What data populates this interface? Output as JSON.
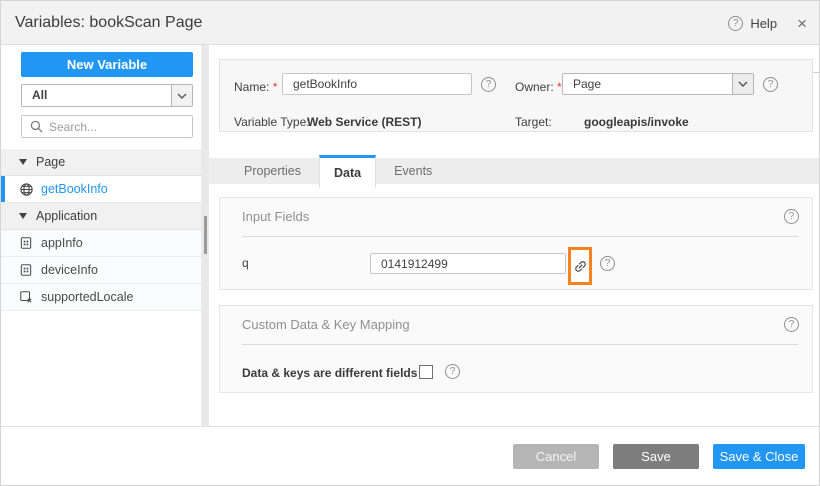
{
  "window": {
    "title": "Variables: bookScan Page"
  },
  "header": {
    "help_label": "Help"
  },
  "sidebar": {
    "new_variable_label": "New Variable",
    "filter_value": "All",
    "search_placeholder": "Search...",
    "tree": [
      {
        "type": "category",
        "label": "Page",
        "expanded": true
      },
      {
        "type": "item",
        "label": "getBookInfo",
        "icon": "web-service-icon",
        "selected": true
      },
      {
        "type": "category",
        "label": "Application",
        "expanded": true
      },
      {
        "type": "item",
        "label": "appInfo",
        "icon": "device-icon",
        "selected": false
      },
      {
        "type": "item",
        "label": "deviceInfo",
        "icon": "device-icon",
        "selected": false
      },
      {
        "type": "item",
        "label": "supportedLocale",
        "icon": "locale-icon",
        "selected": false
      }
    ]
  },
  "form": {
    "name_label": "Name:",
    "required_marker": "*",
    "name_value": "getBookInfo",
    "owner_label": "Owner:",
    "owner_value": "Page",
    "variable_type_label": "Variable Type:",
    "variable_type_value": "Web Service (REST)",
    "target_label": "Target:",
    "target_value": "googleapis/invoke"
  },
  "tabs": [
    {
      "label": "Properties",
      "active": false
    },
    {
      "label": "Data",
      "active": true
    },
    {
      "label": "Events",
      "active": false
    }
  ],
  "sections": {
    "input_fields": {
      "title": "Input Fields",
      "rows": [
        {
          "label": "q",
          "value": "0141912499",
          "mapping_icon": "link-icon",
          "highlighted": true
        }
      ]
    },
    "custom_mapping": {
      "title": "Custom Data & Key Mapping",
      "checkbox_label": "Data & keys are different fields",
      "checkbox_checked": false
    }
  },
  "footer": {
    "cancel_label": "Cancel",
    "save_label": "Save",
    "save_close_label": "Save & Close"
  },
  "colors": {
    "accent_blue": "#2196f3",
    "highlight_orange": "#f5821f",
    "save_gray": "#7d7d7d",
    "cancel_gray": "#b5b5b5"
  }
}
